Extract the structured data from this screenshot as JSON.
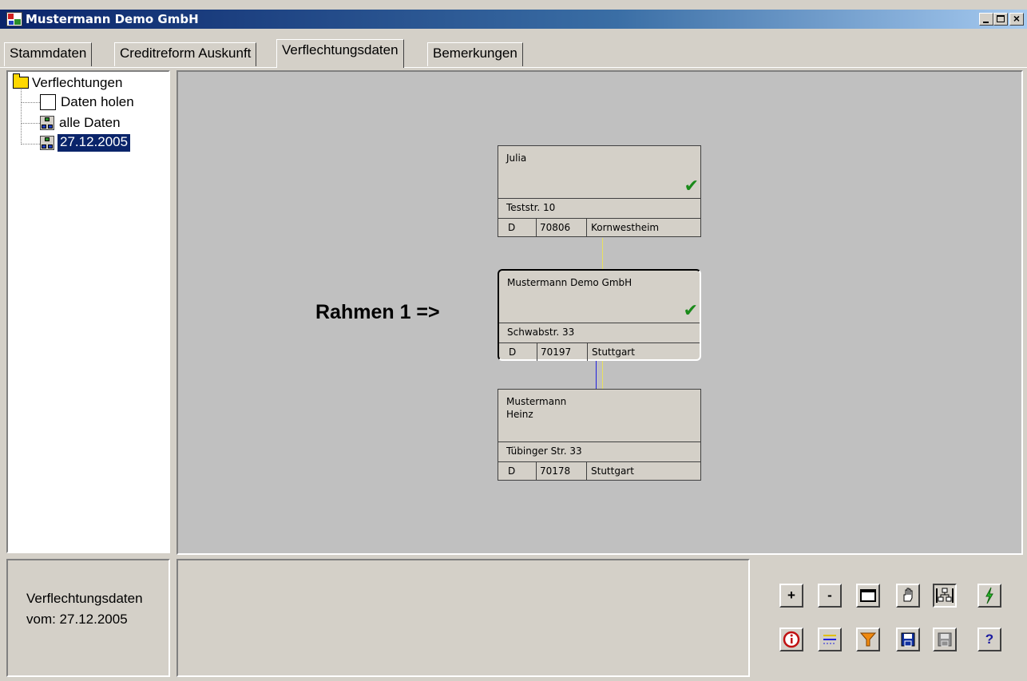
{
  "window": {
    "title": "Mustermann Demo GmbH",
    "controls": {
      "minimize": "_",
      "maximize": "□",
      "close": "×"
    }
  },
  "tabs": [
    {
      "label": "Stammdaten"
    },
    {
      "label": "Creditreform Auskunft"
    },
    {
      "label": "Verflechtungsdaten",
      "active": true
    },
    {
      "label": "Bemerkungen"
    }
  ],
  "tree": {
    "root": "Verflechtungen",
    "items": [
      {
        "label": "Daten holen",
        "icon": "checkbox-icon"
      },
      {
        "label": "alle Daten",
        "icon": "network-icon"
      },
      {
        "label": "27.12.2005",
        "icon": "network-icon",
        "selected": true
      }
    ]
  },
  "canvas": {
    "annotation": "Rahmen 1 =>",
    "nodes": [
      {
        "name": "Julia",
        "checked": true,
        "street": "Teststr. 10",
        "country": "D",
        "zip": "70806",
        "city": "Kornwestheim"
      },
      {
        "name": "Mustermann Demo GmbH",
        "checked": true,
        "street": "Schwabstr. 33",
        "country": "D",
        "zip": "70197",
        "city": "Stuttgart"
      },
      {
        "name": "Mustermann\nHeinz",
        "checked": false,
        "street": "Tübinger Str. 33",
        "country": "D",
        "zip": "70178",
        "city": "Stuttgart"
      }
    ]
  },
  "info": {
    "line1": "Verflechtungsdaten",
    "line2": "vom: 27.12.2005"
  },
  "toolbar": {
    "zoom_in": "+",
    "zoom_out": "-",
    "help": "?"
  },
  "colors": {
    "titlebar": "#0a246a",
    "canvas": "#c0c0c0",
    "check": "#1a8a1a",
    "selection": "#0a246a"
  }
}
